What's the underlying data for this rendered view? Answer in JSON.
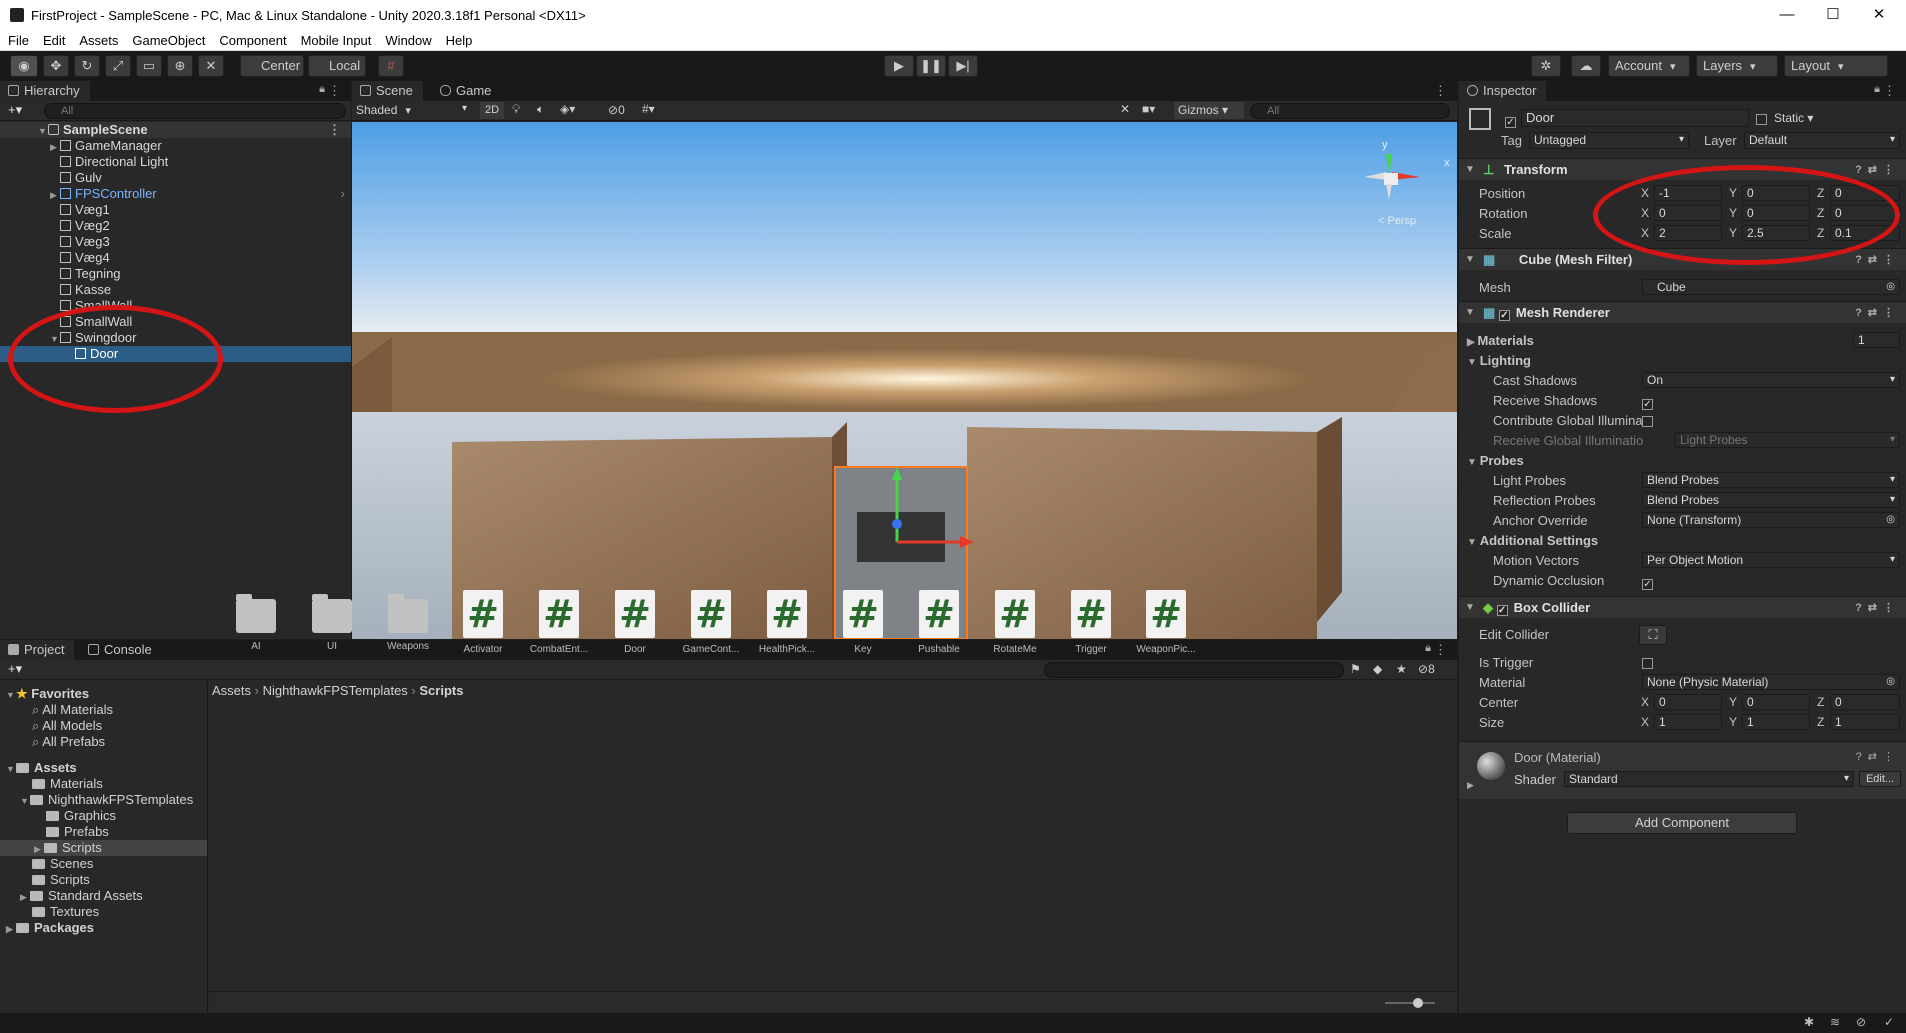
{
  "window": {
    "title": "FirstProject - SampleScene - PC, Mac & Linux Standalone - Unity 2020.3.18f1 Personal <DX11>",
    "minimize": "—",
    "maximize": "☐",
    "close": "✕"
  },
  "menu": [
    "File",
    "Edit",
    "Assets",
    "GameObject",
    "Component",
    "Mobile Input",
    "Window",
    "Help"
  ],
  "toolbar": {
    "center": "Center",
    "local": "Local",
    "account": "Account",
    "layers": "Layers",
    "layout": "Layout"
  },
  "hierarchy": {
    "tab": "Hierarchy",
    "search_placeholder": "All",
    "scene": "SampleScene",
    "items": [
      "GameManager",
      "Directional Light",
      "Gulv",
      "FPSController",
      "Væg1",
      "Væg2",
      "Væg3",
      "Væg4",
      "Tegning",
      "Kasse",
      "SmallWall",
      "SmallWall",
      "Swingdoor",
      "Door"
    ]
  },
  "scene": {
    "tabs": [
      "Scene",
      "Game"
    ],
    "shading": "Shaded",
    "mode2d": "2D",
    "hidden_count": "0",
    "gizmos": "Gizmos",
    "search_placeholder": "All",
    "persp": "< Persp",
    "axis_y": "y",
    "axis_x": "x"
  },
  "project": {
    "tabs": [
      "Project",
      "Console"
    ],
    "hidden_count": "8",
    "favorites": {
      "label": "Favorites",
      "items": [
        "All Materials",
        "All Models",
        "All Prefabs"
      ]
    },
    "assets": {
      "label": "Assets",
      "items": [
        "Materials",
        "NighthawkFPSTemplates",
        "Graphics",
        "Prefabs",
        "Scripts",
        "Scenes",
        "Scripts",
        "Standard Assets",
        "Textures"
      ]
    },
    "packages": "Packages",
    "breadcrumb": [
      "Assets",
      "NighthawkFPSTemplates",
      "Scripts"
    ],
    "files": [
      {
        "name": "AI",
        "kind": "folder"
      },
      {
        "name": "UI",
        "kind": "folder"
      },
      {
        "name": "Weapons",
        "kind": "folder"
      },
      {
        "name": "Activator",
        "kind": "script"
      },
      {
        "name": "CombatEnt...",
        "kind": "script"
      },
      {
        "name": "Door",
        "kind": "script"
      },
      {
        "name": "GameCont...",
        "kind": "script"
      },
      {
        "name": "HealthPick...",
        "kind": "script"
      },
      {
        "name": "Key",
        "kind": "script"
      },
      {
        "name": "Pushable",
        "kind": "script"
      },
      {
        "name": "RotateMe",
        "kind": "script"
      },
      {
        "name": "Trigger",
        "kind": "script"
      },
      {
        "name": "WeaponPic...",
        "kind": "script"
      }
    ],
    "script_glyph": "#"
  },
  "inspector": {
    "tab": "Inspector",
    "object_name": "Door",
    "static": "Static",
    "tag_label": "Tag",
    "tag": "Untagged",
    "layer_label": "Layer",
    "layer": "Default",
    "transform": {
      "title": "Transform",
      "position": {
        "label": "Position",
        "x": "-1",
        "y": "0",
        "z": "0"
      },
      "rotation": {
        "label": "Rotation",
        "x": "0",
        "y": "0",
        "z": "0"
      },
      "scale": {
        "label": "Scale",
        "x": "2",
        "y": "2.5",
        "z": "0.1"
      }
    },
    "mesh_filter": {
      "title": "Cube (Mesh Filter)",
      "mesh_label": "Mesh",
      "mesh": "Cube"
    },
    "mesh_renderer": {
      "title": "Mesh Renderer",
      "materials": "Materials",
      "materials_count": "1",
      "lighting": "Lighting",
      "cast_shadows": "Cast Shadows",
      "cast_shadows_val": "On",
      "receive_shadows": "Receive Shadows",
      "contribute_gi": "Contribute Global Illumina",
      "receive_gi": "Receive Global Illuminatio",
      "receive_gi_val": "Light Probes",
      "probes": "Probes",
      "light_probes": "Light Probes",
      "light_probes_val": "Blend Probes",
      "reflection_probes": "Reflection Probes",
      "reflection_probes_val": "Blend Probes",
      "anchor_override": "Anchor Override",
      "anchor_override_val": "None (Transform)",
      "additional": "Additional Settings",
      "motion_vectors": "Motion Vectors",
      "motion_vectors_val": "Per Object Motion",
      "dynamic_occlusion": "Dynamic Occlusion"
    },
    "box_collider": {
      "title": "Box Collider",
      "edit_collider": "Edit Collider",
      "is_trigger": "Is Trigger",
      "material_label": "Material",
      "material": "None (Physic Material)",
      "center": {
        "label": "Center",
        "x": "0",
        "y": "0",
        "z": "0"
      },
      "size": {
        "label": "Size",
        "x": "1",
        "y": "1",
        "z": "1"
      }
    },
    "material": {
      "title": "Door (Material)",
      "shader_label": "Shader",
      "shader": "Standard",
      "edit": "Edit..."
    },
    "add_component": "Add Component",
    "axes": {
      "x": "X",
      "y": "Y",
      "z": "Z"
    }
  }
}
